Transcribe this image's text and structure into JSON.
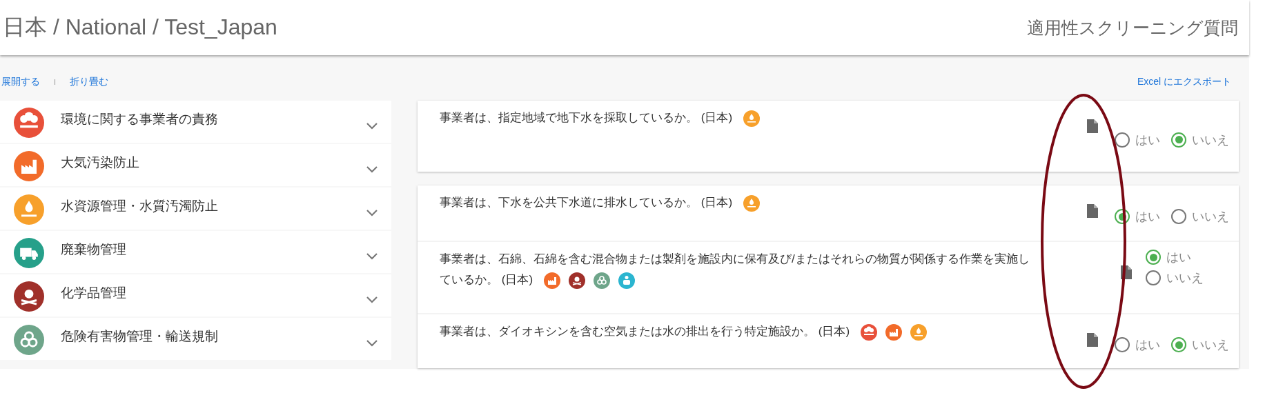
{
  "header": {
    "breadcrumb": "日本 / National / Test_Japan",
    "page_title": "適用性スクリーニング質問"
  },
  "toolbar": {
    "expand": "展開する",
    "separator": "I",
    "collapse": "折り畳む",
    "export": "Excel にエクスポート"
  },
  "sidebar": {
    "items": [
      {
        "label": "環境に関する事業者の責務",
        "icon": {
          "kind": "trees",
          "color": "#e8503a"
        },
        "expanded": false
      },
      {
        "label": "大気汚染防止",
        "icon": {
          "kind": "factory",
          "color": "#f26b2a"
        },
        "expanded": false
      },
      {
        "label": "水資源管理・水質汚濁防止",
        "icon": {
          "kind": "water",
          "color": "#f7a02b"
        },
        "expanded": false
      },
      {
        "label": "廃棄物管理",
        "icon": {
          "kind": "truck",
          "color": "#26a08a"
        },
        "expanded": false
      },
      {
        "label": "化学品管理",
        "icon": {
          "kind": "skull",
          "color": "#a0302a"
        },
        "expanded": false
      },
      {
        "label": "危険有害物管理・輸送規制",
        "icon": {
          "kind": "biohazard",
          "color": "#6ea58a"
        },
        "expanded": false
      }
    ]
  },
  "question_groups": [
    {
      "questions": [
        {
          "text": "事業者は、指定地域で地下水を採取しているか。 (日本)",
          "badges": [
            {
              "kind": "water",
              "color": "#f7a02b"
            }
          ],
          "kind": "inline",
          "options": [
            {
              "label": "はい",
              "selected": false
            },
            {
              "label": "いいえ",
              "selected": true
            }
          ]
        }
      ]
    },
    {
      "questions": [
        {
          "text": "事業者は、下水を公共下水道に排水しているか。 (日本)",
          "badges": [
            {
              "kind": "water",
              "color": "#f7a02b"
            }
          ],
          "kind": "inline",
          "options": [
            {
              "label": "はい",
              "selected": true
            },
            {
              "label": "いいえ",
              "selected": false
            }
          ]
        },
        {
          "text": "事業者は、石綿、石綿を含む混合物または製剤を施設内に保有及び/またはそれらの物質が関係する作業を実施しているか。 (日本)",
          "badges": [
            {
              "kind": "factory",
              "color": "#f26b2a"
            },
            {
              "kind": "skull",
              "color": "#a0302a"
            },
            {
              "kind": "biohazard",
              "color": "#6ea58a"
            },
            {
              "kind": "medical",
              "color": "#2bb5d0"
            }
          ],
          "kind": "stacked",
          "options": [
            {
              "label": "はい",
              "selected": true
            },
            {
              "label": "いいえ",
              "selected": false
            }
          ]
        },
        {
          "text": "事業者は、ダイオキシンを含む空気または水の排出を行う特定施設か。 (日本)",
          "badges": [
            {
              "kind": "trees",
              "color": "#e8503a"
            },
            {
              "kind": "factory",
              "color": "#f26b2a"
            },
            {
              "kind": "water",
              "color": "#f7a02b"
            }
          ],
          "kind": "inline",
          "options": [
            {
              "label": "はい",
              "selected": false
            },
            {
              "label": "いいえ",
              "selected": true
            }
          ]
        }
      ]
    }
  ],
  "annotation": {
    "kind": "ellipse",
    "color": "#7a0a14"
  }
}
